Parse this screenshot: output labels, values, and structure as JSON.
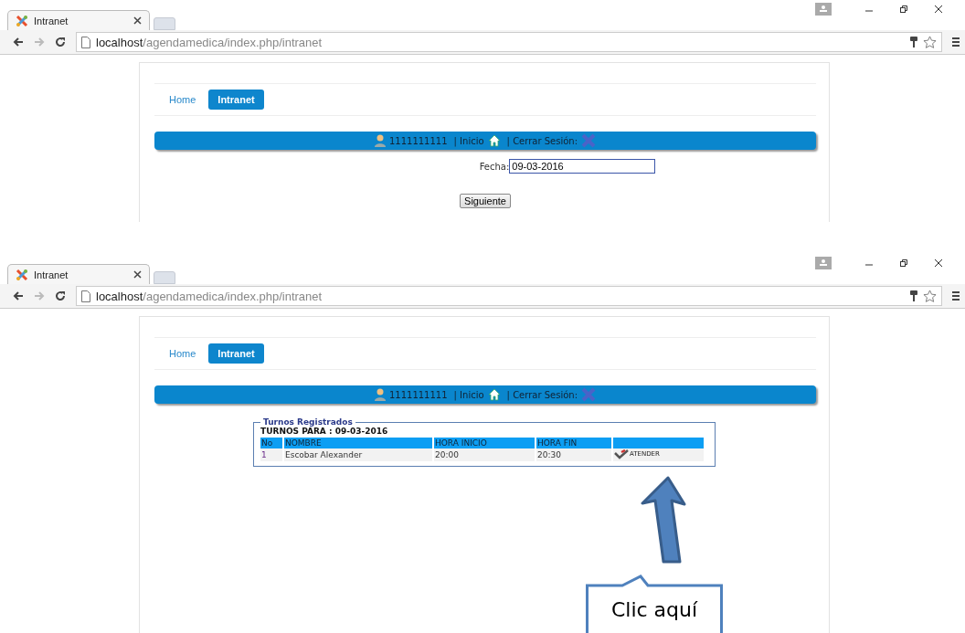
{
  "screenshots": [
    {
      "kind": "date_form",
      "browser": {
        "tab_title": "Intranet",
        "url_host": "localhost",
        "url_path": "/agendamedica/index.php/intranet"
      },
      "nav": [
        {
          "label": "Home",
          "selected": false
        },
        {
          "label": "Intranet",
          "selected": true
        }
      ],
      "user_bar": {
        "user": "1111111111",
        "inicio": "| Inicio",
        "logout": "| Cerrar Sesión:"
      },
      "form": {
        "label": "Fecha:",
        "value": "09-03-2016",
        "button": "Siguiente"
      }
    },
    {
      "kind": "appointments",
      "browser": {
        "tab_title": "Intranet",
        "url_host": "localhost",
        "url_path": "/agendamedica/index.php/intranet"
      },
      "nav": [
        {
          "label": "Home",
          "selected": false
        },
        {
          "label": "Intranet",
          "selected": true
        }
      ],
      "user_bar": {
        "user": "1111111111",
        "inicio": "| Inicio",
        "logout": "| Cerrar Sesión:"
      },
      "fieldset": {
        "legend": "Turnos Registrados",
        "heading": "TURNOS PARA : 09-03-2016",
        "columns": [
          "No",
          "NOMBRE",
          "HORA INICIO",
          "HORA FIN"
        ],
        "rows": [
          {
            "no": "1",
            "name": "Escobar Alexander",
            "start": "20:00",
            "end": "20:30",
            "action": "ATENDER"
          }
        ]
      },
      "callout": {
        "text": "Clic aquí"
      }
    }
  ]
}
